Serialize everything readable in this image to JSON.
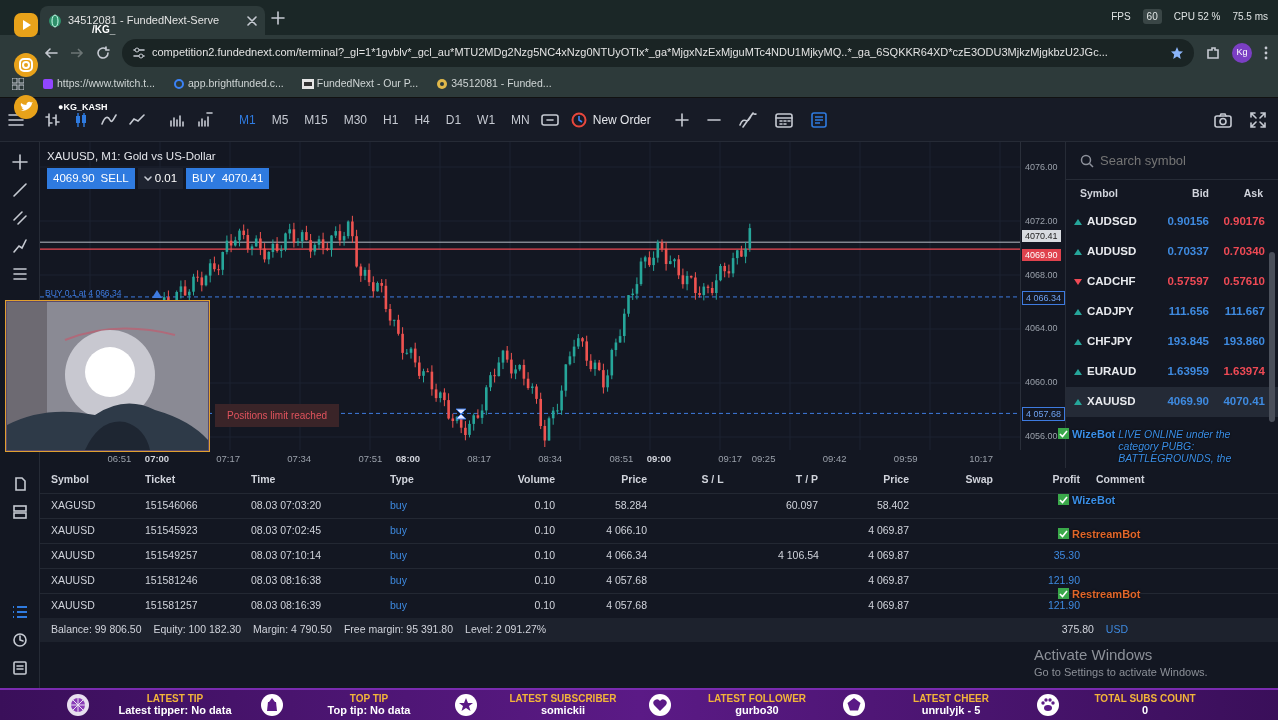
{
  "stream_overlay": {
    "channel_tag": "/KG_",
    "channel_name": "●KG_KASH",
    "stats": [
      "FPS",
      "60",
      "CPU 52 %",
      "75.5 ms"
    ]
  },
  "browser": {
    "tab_title": "34512081 - FundedNext-Serve",
    "address": "competition2.fundednext.com/terminal?_gl=1*1gvblv*_gcl_au*MTU2MDg2Nzg5NC4xNzg0NTUyOTIx*_ga*MjgxNzExMjguMTc4NDU1MjkyMQ..*_ga_6SQKKR64XD*czE3ODU3MjkzMjgkbzU2JGc...",
    "profile_initials": "Kg",
    "bookmarks": [
      {
        "label": "https://www.twitch.t..."
      },
      {
        "label": "app.brightfunded.c..."
      },
      {
        "label": "FundedNext - Our P..."
      },
      {
        "label": "34512081 - Funded..."
      }
    ]
  },
  "toolbar": {
    "timeframes": [
      {
        "label": "M1",
        "selected": true
      },
      {
        "label": "M5",
        "selected": false
      },
      {
        "label": "M15",
        "selected": false
      },
      {
        "label": "M30",
        "selected": false
      },
      {
        "label": "H1",
        "selected": false
      },
      {
        "label": "H4",
        "selected": false
      },
      {
        "label": "D1",
        "selected": false
      },
      {
        "label": "W1",
        "selected": false
      },
      {
        "label": "MN",
        "selected": false
      }
    ],
    "new_order": "New Order"
  },
  "chart": {
    "title": "XAUUSD, M1: Gold vs US-Dollar",
    "sell": {
      "price": "4069.90",
      "label": "SELL"
    },
    "volume": "0.01",
    "buy": {
      "label": "BUY",
      "price": "4070.41"
    },
    "order_line": "BUY 0.1 at 4 066.34",
    "notice": "Positions limit reached",
    "price_labels": [
      {
        "text": "4076.00",
        "kind": "tick"
      },
      {
        "text": "4072.00",
        "kind": "tick"
      },
      {
        "text": "4070.41",
        "kind": "ask"
      },
      {
        "text": "4069.90",
        "kind": "bid"
      },
      {
        "text": "4068.00",
        "kind": "tick"
      },
      {
        "text": "4 066.34",
        "kind": "position"
      },
      {
        "text": "4064.00",
        "kind": "tick"
      },
      {
        "text": "4060.00",
        "kind": "tick"
      },
      {
        "text": "4 057.68",
        "kind": "position"
      },
      {
        "text": "4056.00",
        "kind": "tick"
      }
    ],
    "time_labels": [
      {
        "text": "06:51",
        "major": false
      },
      {
        "text": "07:00",
        "major": true
      },
      {
        "text": "07:17",
        "major": false
      },
      {
        "text": "07:34",
        "major": false
      },
      {
        "text": "07:51",
        "major": false
      },
      {
        "text": "08:00",
        "major": true
      },
      {
        "text": "08:17",
        "major": false
      },
      {
        "text": "08:34",
        "major": false
      },
      {
        "text": "08:51",
        "major": false
      },
      {
        "text": "09:00",
        "major": true
      },
      {
        "text": "09:17",
        "major": false
      },
      {
        "text": "09:25",
        "major": false
      },
      {
        "text": "09:42",
        "major": false
      },
      {
        "text": "09:59",
        "major": false
      },
      {
        "text": "10:17",
        "major": false
      }
    ]
  },
  "market_watch": {
    "search_placeholder": "Search symbol",
    "columns": [
      "Symbol",
      "Bid",
      "Ask"
    ],
    "rows": [
      {
        "symbol": "AUDSGD",
        "bid": "0.90156",
        "ask": "0.90176",
        "rising": true,
        "bid_up": true,
        "ask_up": false,
        "selected": false
      },
      {
        "symbol": "AUDUSD",
        "bid": "0.70337",
        "ask": "0.70340",
        "rising": true,
        "bid_up": true,
        "ask_up": false,
        "selected": false
      },
      {
        "symbol": "CADCHF",
        "bid": "0.57597",
        "ask": "0.57610",
        "rising": false,
        "bid_up": false,
        "ask_up": false,
        "selected": false
      },
      {
        "symbol": "CADJPY",
        "bid": "111.656",
        "ask": "111.667",
        "rising": true,
        "bid_up": true,
        "ask_up": true,
        "selected": false
      },
      {
        "symbol": "CHFJPY",
        "bid": "193.845",
        "ask": "193.860",
        "rising": true,
        "bid_up": true,
        "ask_up": true,
        "selected": false
      },
      {
        "symbol": "EURAUD",
        "bid": "1.63959",
        "ask": "1.63974",
        "rising": true,
        "bid_up": true,
        "ask_up": false,
        "selected": false
      },
      {
        "symbol": "XAUUSD",
        "bid": "4069.90",
        "ask": "4070.41",
        "rising": true,
        "bid_up": true,
        "ask_up": true,
        "selected": true
      }
    ]
  },
  "positions": {
    "columns": [
      "Symbol",
      "Ticket",
      "Time",
      "Type",
      "Volume",
      "Price",
      "S / L",
      "T / P",
      "Price",
      "Swap",
      "Profit",
      "Comment"
    ],
    "rows": [
      {
        "symbol": "XAGUSD",
        "ticket": "151546066",
        "time": "08.03 07:03:20",
        "type": "buy",
        "volume": "0.10",
        "price": "58.284",
        "tp": "60.097",
        "current_price": "58.402"
      },
      {
        "symbol": "XAUUSD",
        "ticket": "151545923",
        "time": "08.03 07:02:45",
        "type": "buy",
        "volume": "0.10",
        "price": "4 066.10",
        "current_price": "4 069.87"
      },
      {
        "symbol": "XAUUSD",
        "ticket": "151549257",
        "time": "08.03 07:10:14",
        "type": "buy",
        "volume": "0.10",
        "price": "4 066.34",
        "tp": "4 106.54",
        "current_price": "4 069.87",
        "profit": "35.30"
      },
      {
        "symbol": "XAUUSD",
        "ticket": "151581246",
        "time": "08.03 08:16:38",
        "type": "buy",
        "volume": "0.10",
        "price": "4 057.68",
        "current_price": "4 069.87",
        "profit": "121.90"
      },
      {
        "symbol": "XAUUSD",
        "ticket": "151581257",
        "time": "08.03 08:16:39",
        "type": "buy",
        "volume": "0.10",
        "price": "4 057.68",
        "current_price": "4 069.87",
        "profit": "121.90"
      }
    ],
    "summary": [
      "Balance: 99 806.50",
      "Equity: 100 182.30",
      "Margin: 4 790.50",
      "Free margin: 95 391.80",
      "Level: 2 091.27%"
    ],
    "total_profit": "375.80",
    "currency": "USD"
  },
  "chat_overlay": [
    {
      "author": "WizeBot",
      "message": "LIVE ONLINE under the category PUBG: BATTLEGROUNDS, the",
      "color": "#3a8ee6"
    },
    {
      "author": "WizeBot",
      "color": "#3a8ee6"
    },
    {
      "author": "RestreamBot",
      "color": "#e0662a"
    },
    {
      "author": "RestreamBot",
      "color": "#e0662a"
    }
  ],
  "windows_notice": {
    "title": "Activate Windows",
    "message": "Go to Settings to activate Windows."
  },
  "stream_bar": [
    {
      "title": "LATEST TIP",
      "value": "Latest tipper: No data"
    },
    {
      "title": "TOP TIP",
      "value": "Top tip: No data"
    },
    {
      "title": "LATEST SUBSCRIBER",
      "value": "somickii"
    },
    {
      "title": "LATEST FOLLOWER",
      "value": "gurbo30"
    },
    {
      "title": "LATEST CHEER",
      "value": "unrulyjk - 5"
    },
    {
      "title": "TOTAL SUBS COUNT",
      "value": "0"
    }
  ]
}
